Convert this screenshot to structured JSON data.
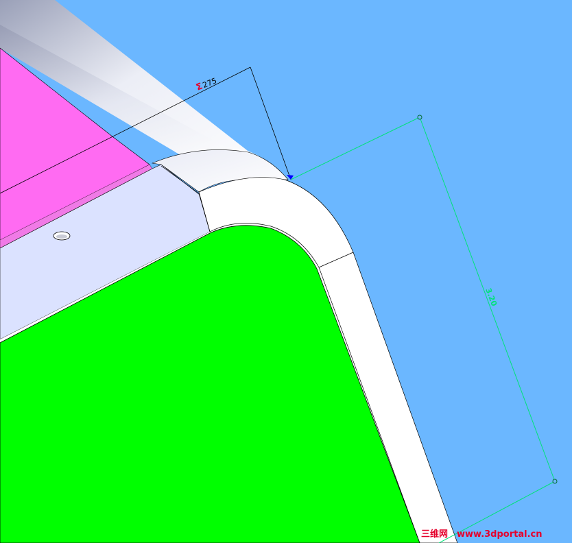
{
  "viewport": {
    "background_color": "#6bb7ff"
  },
  "dimensions": {
    "angle_dimension": {
      "symbol": "Σ",
      "value": "275",
      "symbol_color": "#e5002b"
    },
    "length_dimension": {
      "value": "3.20",
      "color": "#00e27a"
    }
  },
  "faces": {
    "pink_face_color": "#ff6bf2",
    "green_face_color": "#00ff00",
    "light_face_color": "#dbe2ff",
    "white_face_color": "#ffffff"
  },
  "watermark": {
    "cn_text": "三维网",
    "url_text": "www.3dportal.cn",
    "color": "#e5002b"
  }
}
